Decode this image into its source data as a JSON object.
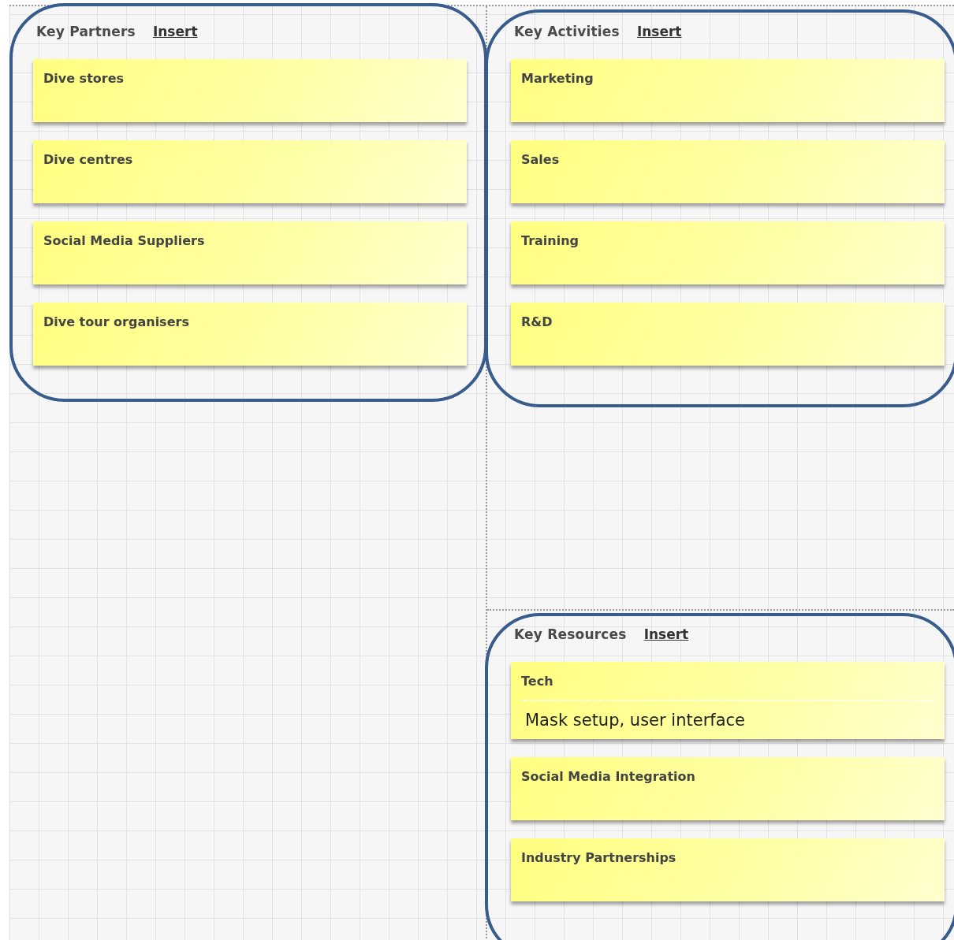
{
  "sections": [
    {
      "title": "Key Partners",
      "action": "Insert",
      "notes": [
        {
          "title": "Dive stores"
        },
        {
          "title": "Dive centres"
        },
        {
          "title": "Social Media Suppliers"
        },
        {
          "title": "Dive tour organisers"
        }
      ]
    },
    {
      "title": "Key Activities",
      "action": "Insert",
      "notes": [
        {
          "title": "Marketing"
        },
        {
          "title": "Sales"
        },
        {
          "title": "Training"
        },
        {
          "title": "R&D"
        }
      ]
    },
    {
      "title": "Key Resources",
      "action": "Insert",
      "notes": [
        {
          "title": "Tech",
          "description": "Mask setup, user interface"
        },
        {
          "title": "Social Media Integration"
        },
        {
          "title": "Industry Partnerships"
        }
      ]
    }
  ]
}
